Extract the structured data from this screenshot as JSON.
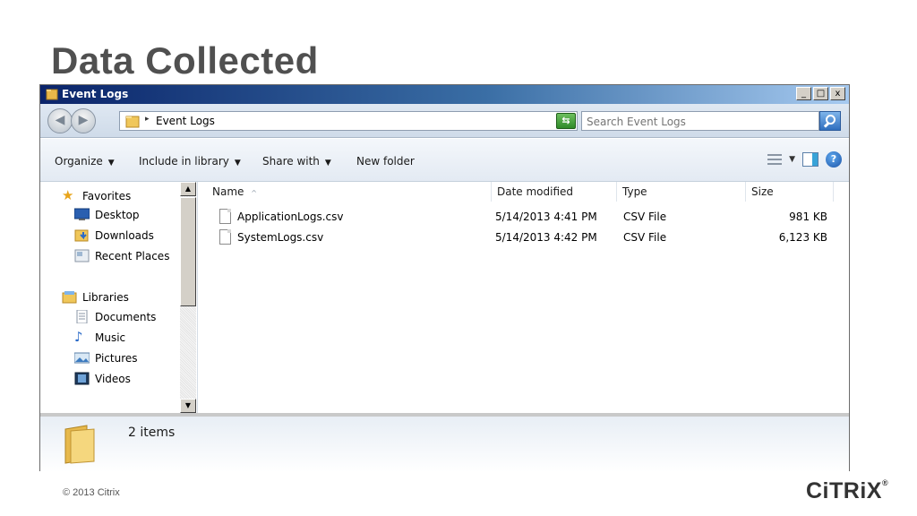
{
  "slide": {
    "title": "Data Collected",
    "copyright": "© 2013 Citrix",
    "logo": "CiTRiX",
    "logo_mark": "®"
  },
  "window": {
    "title": "Event Logs",
    "buttons": {
      "minimize": "_",
      "maximize": "□",
      "close": "x"
    }
  },
  "address": {
    "path": "Event Logs",
    "separator": "▸"
  },
  "search": {
    "placeholder": "Search Event Logs"
  },
  "toolbar": {
    "organize": "Organize",
    "include_in_library": "Include in library",
    "share_with": "Share with",
    "new_folder": "New folder",
    "help": "?"
  },
  "navigation": {
    "favorites": {
      "label": "Favorites",
      "items": [
        "Desktop",
        "Downloads",
        "Recent Places"
      ]
    },
    "libraries": {
      "label": "Libraries",
      "items": [
        "Documents",
        "Music",
        "Pictures",
        "Videos"
      ]
    }
  },
  "filelist": {
    "columns": [
      "Name",
      "Date modified",
      "Type",
      "Size"
    ],
    "sort_indicator": "^",
    "rows": [
      {
        "name": "ApplicationLogs.csv",
        "date": "5/14/2013 4:41 PM",
        "type": "CSV File",
        "size": "981 KB"
      },
      {
        "name": "SystemLogs.csv",
        "date": "5/14/2013 4:42 PM",
        "type": "CSV File",
        "size": "6,123 KB"
      }
    ]
  },
  "details": {
    "count": "2 items"
  },
  "colors": {
    "title_gradient_start": "#0a246a",
    "title_gradient_end": "#a6caf0",
    "slide_title": "#505050"
  }
}
